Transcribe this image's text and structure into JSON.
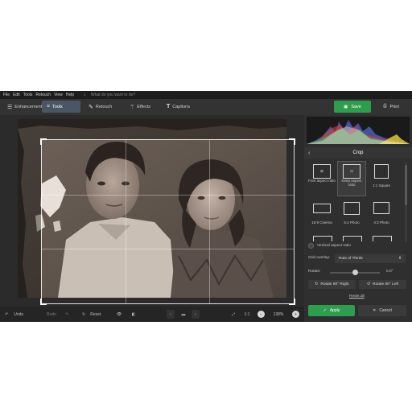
{
  "menu": [
    "File",
    "Edit",
    "Tools",
    "Retouch",
    "View",
    "Help"
  ],
  "search_placeholder": "What do you want to do?",
  "tabs": [
    {
      "label": "Enhancement",
      "icon": "sliders-icon"
    },
    {
      "label": "Tools",
      "icon": "crop-icon"
    },
    {
      "label": "Retouch",
      "icon": "brush-icon"
    },
    {
      "label": "Effects",
      "icon": "magic-wand-icon"
    },
    {
      "label": "Captions",
      "icon": "text-icon"
    }
  ],
  "toolbar": {
    "save": "Save",
    "print": "Print"
  },
  "bottombar": {
    "undo": "Undo",
    "redo": "Redo",
    "reset": "Reset",
    "ratio": "1:1",
    "zoom": "138%"
  },
  "panel": {
    "title": "Crop",
    "presets": [
      {
        "label": "Free aspect ratio"
      },
      {
        "label": "Keep aspect ratio"
      },
      {
        "label": "1:1 Square"
      },
      {
        "label": "16:9 Cinema"
      },
      {
        "label": "5:4 Photo"
      },
      {
        "label": "4:3 Photo"
      }
    ],
    "vertical_label": "Vertical aspect ratio",
    "grid_label": "Grid overlay:",
    "grid_value": "Rule of Thirds",
    "rotate_label": "Rotate:",
    "rotate_value": "0.0°",
    "rotate_right": "Rotate 90° Right",
    "rotate_left": "Rotate 90° Left",
    "reset_all": "Reset all",
    "apply": "Apply",
    "cancel": "Cancel"
  },
  "colors": {
    "accent_green": "#2e9d4d",
    "active_tab": "#4a5663"
  }
}
